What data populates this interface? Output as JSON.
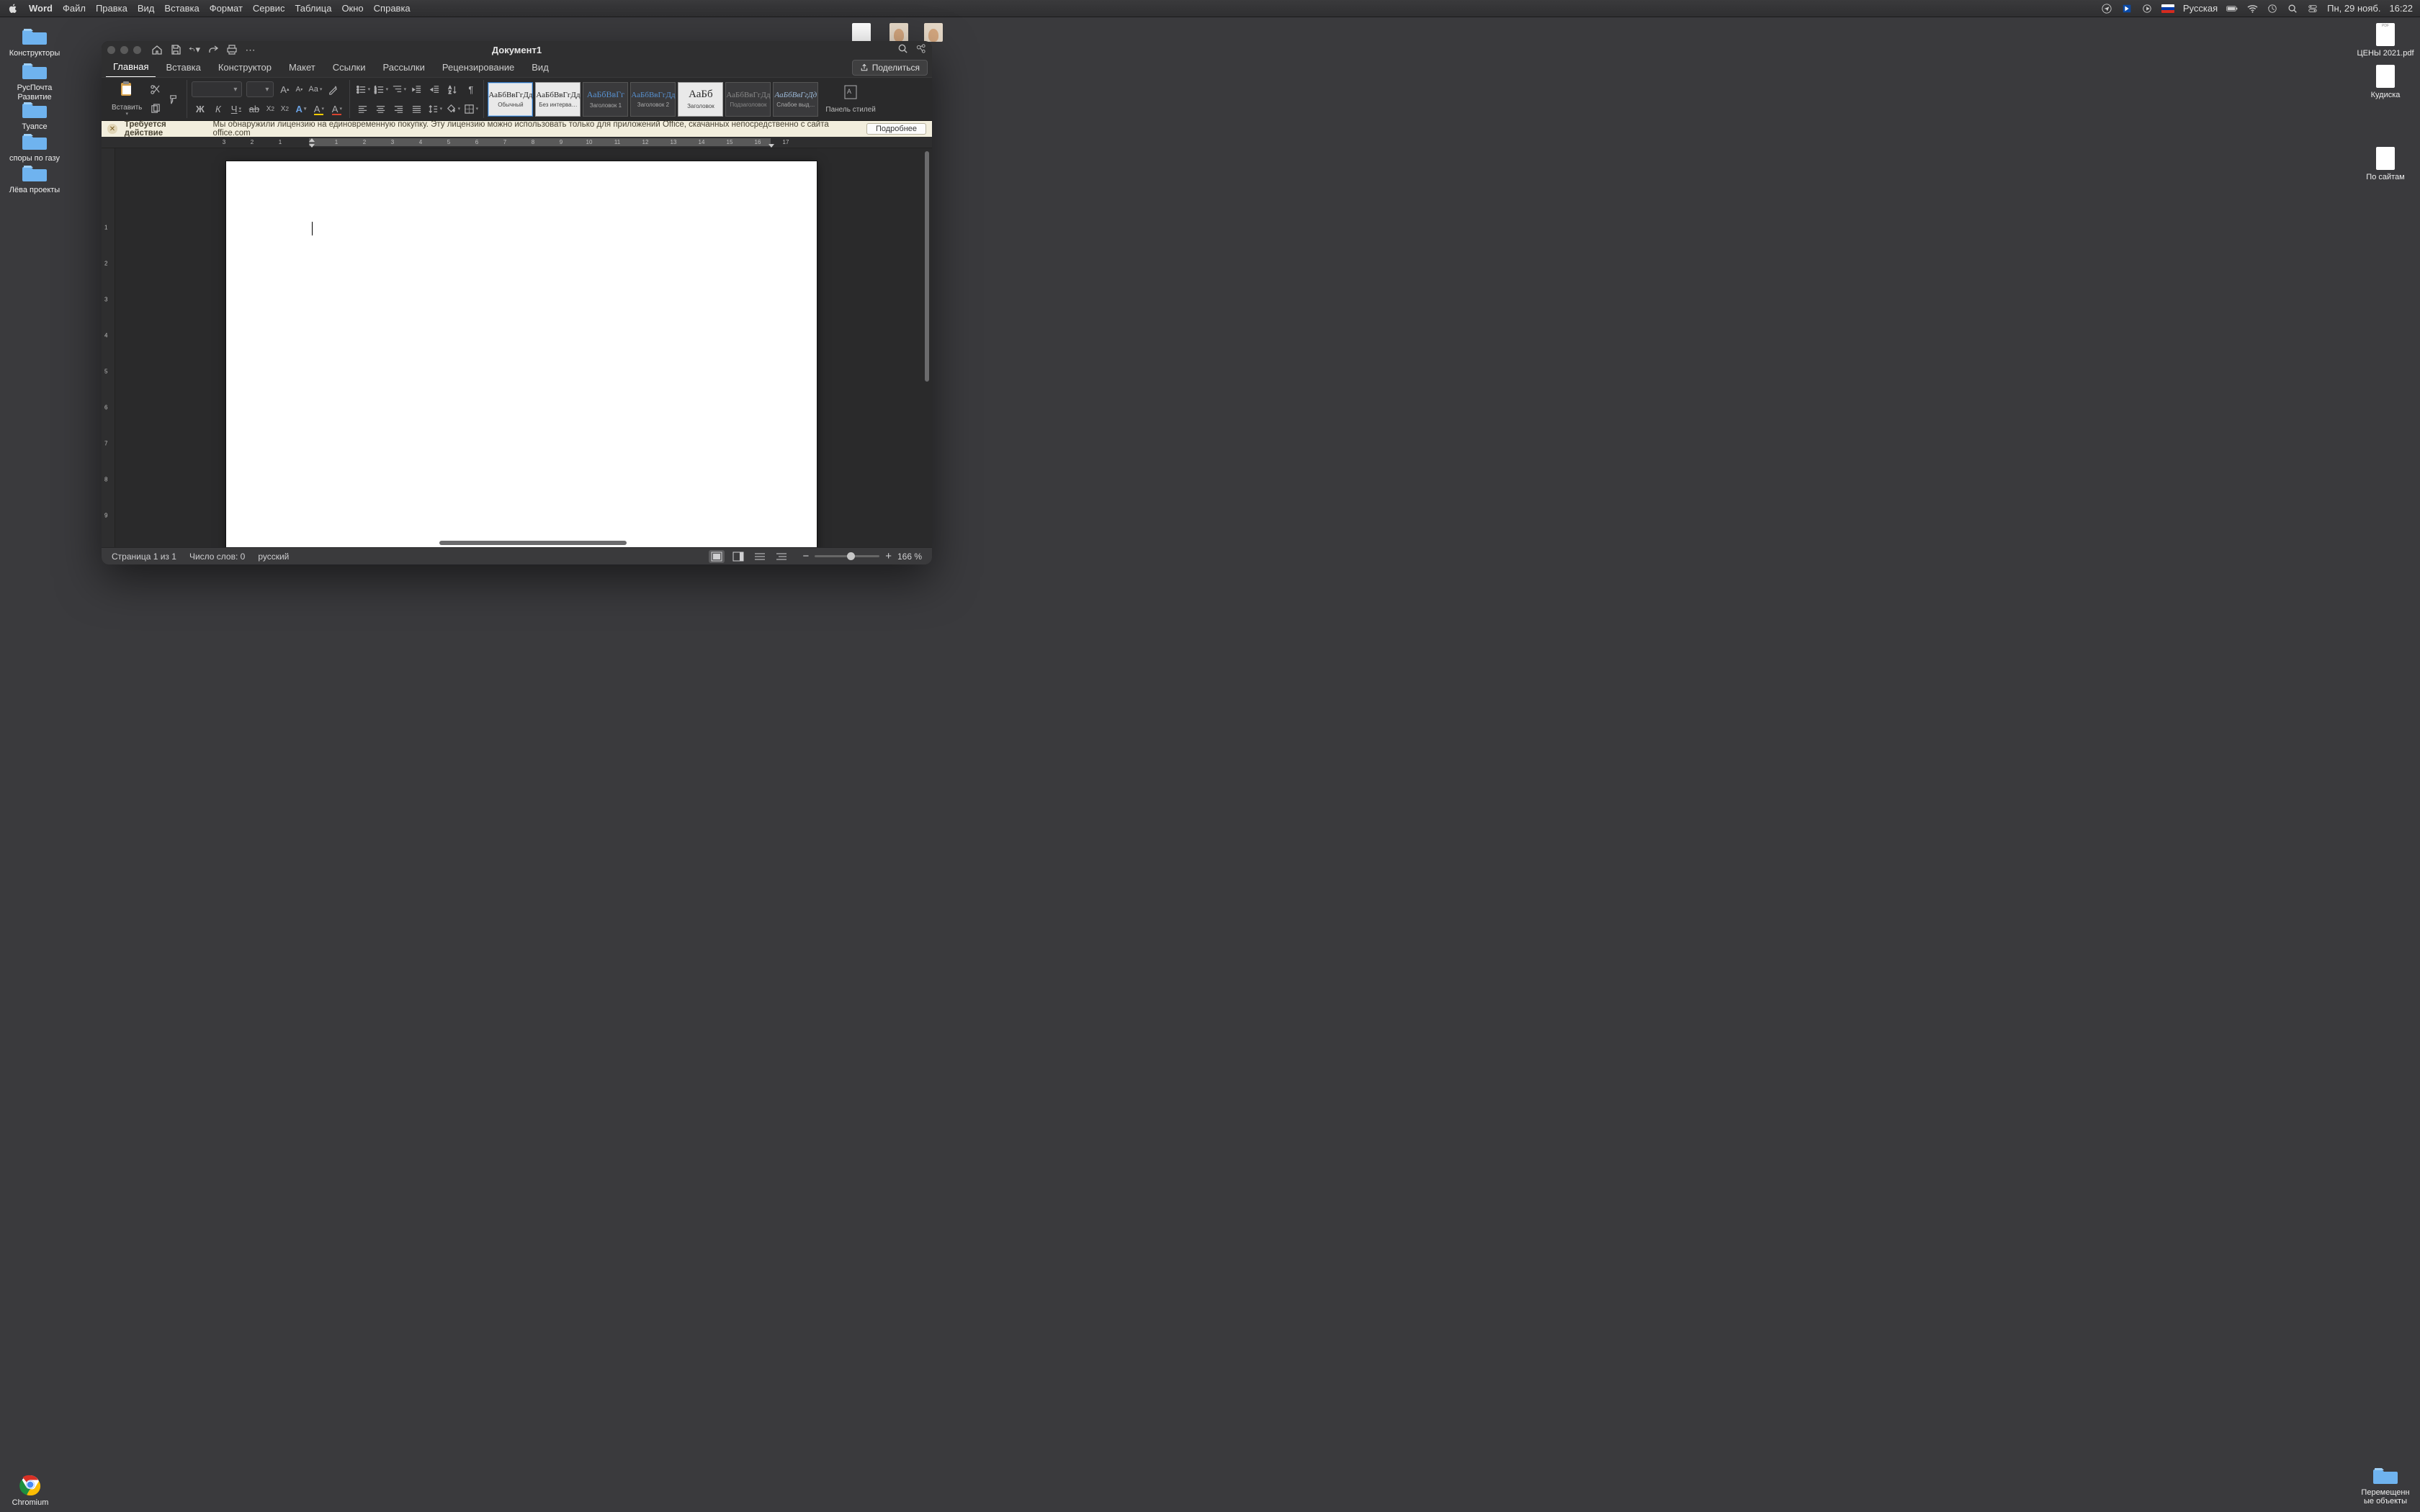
{
  "menubar": {
    "apple_icon_name": "apple-icon",
    "app": "Word",
    "items": [
      "Файл",
      "Правка",
      "Вид",
      "Вставка",
      "Формат",
      "Сервис",
      "Таблица",
      "Окно",
      "Справка"
    ],
    "right": {
      "input_lang": "Русская",
      "date": "Пн, 29 нояб.",
      "time": "16:22"
    }
  },
  "desktop": {
    "left_folders": [
      {
        "label": "Конструкторы"
      },
      {
        "label": "РусПочта Развитие"
      },
      {
        "label": "Туапсе"
      },
      {
        "label": "споры по газу"
      },
      {
        "label": "Лёва проекты"
      }
    ],
    "right_icons": [
      {
        "label": "ЦЕНЫ 2021.pdf",
        "type": "pdf"
      },
      {
        "label": "Кудиска",
        "type": "doc"
      },
      {
        "label": "По сайтам",
        "type": "doc"
      },
      {
        "label": "Перемещенн ые объекты",
        "type": "folder"
      }
    ],
    "top_thumbs": [
      {
        "label": ""
      },
      {
        "label": ""
      },
      {
        "label": ""
      }
    ],
    "bottom_left": [
      {
        "label": "Chromium",
        "type": "chromium"
      }
    ]
  },
  "window": {
    "title": "Документ1",
    "qat": {
      "home": "⌂",
      "save": "💾",
      "undo": "↶",
      "redo": "↷",
      "print": "🖨",
      "more": "⋯"
    },
    "tb_right": {
      "search": "⌕",
      "share_quick": "🔗"
    },
    "tabs": [
      "Главная",
      "Вставка",
      "Конструктор",
      "Макет",
      "Ссылки",
      "Рассылки",
      "Рецензирование",
      "Вид"
    ],
    "share": "Поделиться",
    "ribbon": {
      "paste": "Вставить",
      "styles": [
        {
          "sample": "АаБбВвГгДд",
          "name": "Обычный"
        },
        {
          "sample": "АаБбВвГгДд",
          "name": "Без интерва…"
        },
        {
          "sample": "АаБбВвГг",
          "name": "Заголовок 1"
        },
        {
          "sample": "АаБбВвГгДд",
          "name": "Заголовок 2"
        },
        {
          "sample": "АаБб",
          "name": "Заголовок"
        },
        {
          "sample": "АаБбВвГгДд",
          "name": "Подзаголовок"
        },
        {
          "sample": "АаБбВвГгДд",
          "name": "Слабое выд…"
        }
      ],
      "styles_pane": "Панель стилей"
    },
    "banner": {
      "title": "Требуется действие",
      "text": "Мы обнаружили лицензию на единовременную покупку. Эту лицензию можно использовать только для приложений Office, скачанных непосредственно с сайта office.com",
      "button": "Подробнее"
    },
    "ruler": {
      "labels": [
        "3",
        "2",
        "1",
        "",
        "1",
        "2",
        "3",
        "4",
        "5",
        "6",
        "7",
        "8",
        "9",
        "10",
        "11",
        "12",
        "13",
        "14",
        "15",
        "16",
        "17"
      ]
    },
    "statusbar": {
      "page": "Страница 1 из 1",
      "words": "Число слов: 0",
      "lang": "русский",
      "zoom": "166 %"
    }
  }
}
